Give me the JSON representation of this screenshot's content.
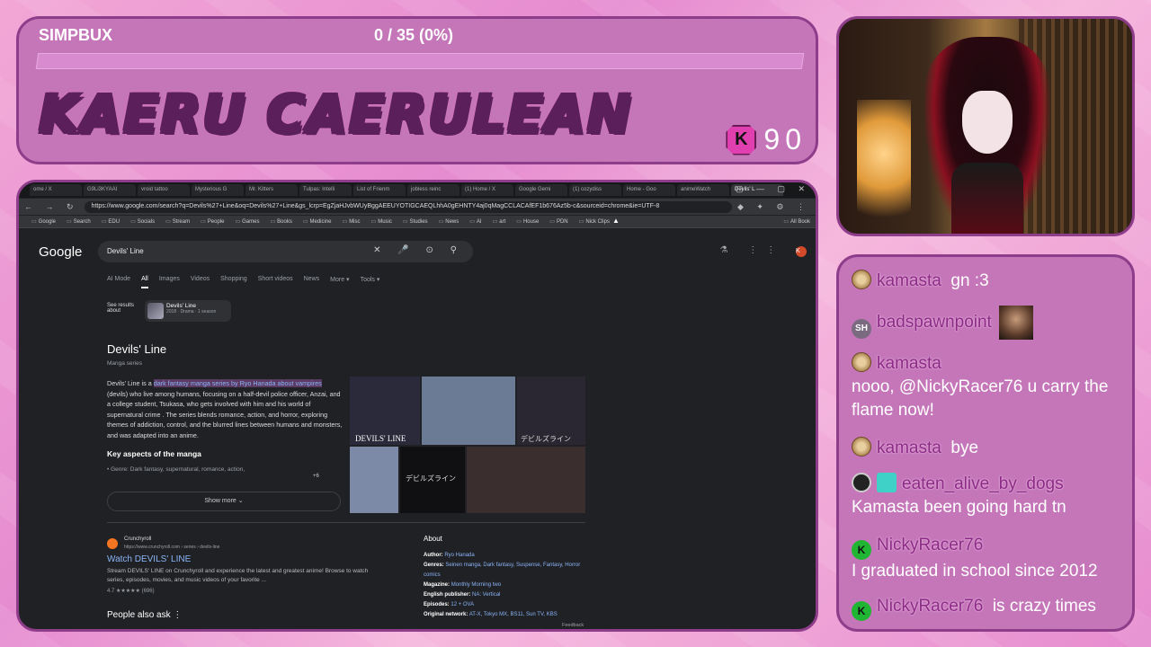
{
  "overlay": {
    "simpbux_label": "SIMPBUX",
    "progress_text": "0 / 35 (0%)",
    "progress_fraction": 0,
    "streamer_name": "KAERU CAERULEAN",
    "coin_letter": "K",
    "coin_count": "90"
  },
  "chat": {
    "messages": [
      {
        "user": "kamasta",
        "text": "gn :3",
        "badge": "cookie"
      },
      {
        "user": "badspawnpoint",
        "text": "",
        "badge": "SH"
      },
      {
        "user": "kamasta",
        "text": "nooo, @NickyRacer76 u carry the flame now!",
        "badge": "cookie"
      },
      {
        "user": "kamasta",
        "text": "bye",
        "badge": "cookie"
      },
      {
        "user": "eaten_alive_by_dogs",
        "text": "Kamasta been going hard tn",
        "badge": "x"
      },
      {
        "user": "NickyRacer76",
        "text": "I graduated in school since 2012",
        "badge": "K"
      },
      {
        "user": "NickyRacer76",
        "text": "is crazy times",
        "badge": "K"
      }
    ]
  },
  "browser": {
    "tabs": [
      "ome / X",
      "G9Li3KYAAI",
      "vroid tattoo",
      "Mysterious G",
      "Mr. Kitters",
      "Tulpas: Intelli",
      "List of Frienm",
      "jobless reinc",
      "(1) Home / X",
      "Google Gemi",
      "(1) cozydiss",
      "Home - Goo",
      "animeWatch",
      "Devils' L"
    ],
    "url": "https://www.google.com/search?q=Devils%27+Line&oq=Devils%27+Line&gs_lcrp=EgZjaHJvbWUyBggAEEUYOTIGCAEQLhhA0gEHNTY4aj0qMagCCLACAfEF1b676Az5b-c&sourceid=chrome&ie=UTF-8",
    "bookmarks": [
      "Google",
      "Search",
      "EDU",
      "Socials",
      "Stream",
      "People",
      "Games",
      "Books",
      "Medicine",
      "Misc",
      "Music",
      "Studies",
      "News",
      "AI",
      "art",
      "House",
      "PDN",
      "Nick Clips"
    ],
    "all_bookmarks": "All Book"
  },
  "google": {
    "logo": "Google",
    "query": "Devils' Line",
    "filters": [
      "AI Mode",
      "All",
      "Images",
      "Videos",
      "Shopping",
      "Short videos",
      "News",
      "More ▾",
      "Tools ▾"
    ],
    "active_filter": "All",
    "see_results": "See results about",
    "entity_title": "Devils' Line",
    "entity_sub": "2018 · Drama · 1 season",
    "kp_title": "Devils' Line",
    "kp_subtitle": "Manga series",
    "desc_start": "Devils' Line is a ",
    "desc_highlight": "dark fantasy manga series by Ryo Hanada about vampires",
    "desc_rest": " (devils) who live among humans, focusing on a half-devil police officer, Anzai, and a college student, Tsukasa, who gets involved with him and his world of supernatural crime . The series blends romance, action, and horror, exploring themes of addiction, control, and the blurred lines between humans and monsters, and was adapted into an anime.",
    "aspects_heading": "Key aspects of the manga",
    "genre_line": "• Genre: Dark fantasy, supernatural, romance, action,",
    "more_sources": "+6",
    "show_more": "Show more ⌄",
    "result_site": "Crunchyroll",
    "result_url": "https://www.crunchyroll.com › series › devils-line",
    "result_title": "Watch DEVILS' LINE",
    "result_snippet": "Stream DEVILS' LINE on Crunchyroll and experience the latest and greatest anime! Browse to watch series, episodes, movies, and music videos of your favorite ...",
    "result_rating": "4.7 ★★★★★ (696)",
    "people_also_ask": "People also ask  ⋮",
    "about_title": "About",
    "about": [
      {
        "label": "Author:",
        "value": "Ryo Hanada"
      },
      {
        "label": "Genres:",
        "value": "Seinen manga, Dark fantasy, Suspense, Fantasy, Horror comics"
      },
      {
        "label": "Magazine:",
        "value": "Monthly Morning two"
      },
      {
        "label": "English publisher:",
        "value": "NA: Vertical"
      },
      {
        "label": "Episodes:",
        "value": "12 + OVA"
      },
      {
        "label": "Original network:",
        "value": "AT-X, Tokyo MX, BS11, Sun TV, KBS"
      }
    ],
    "feedback": "Feedback",
    "image_captions": [
      "DEVILS' LINE",
      "デビルズライン",
      "デビルズライン"
    ]
  }
}
